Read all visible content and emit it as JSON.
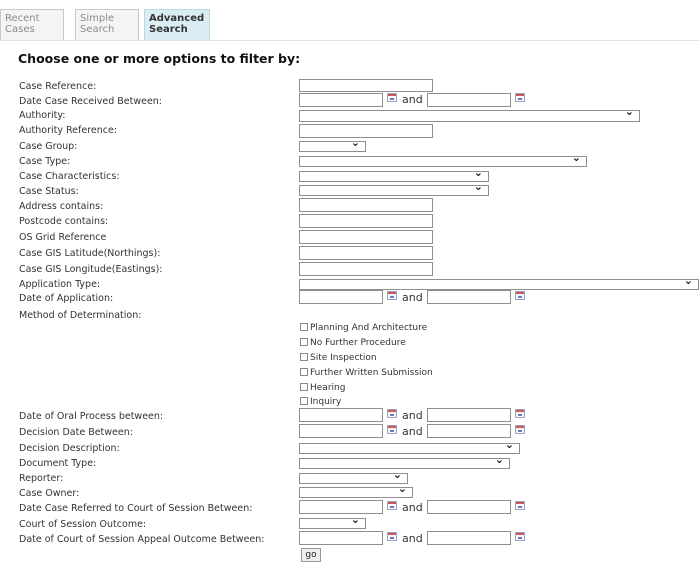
{
  "tabs": [
    {
      "l1": "Recent",
      "l2": "Cases"
    },
    {
      "l1": "Simple",
      "l2": "Search"
    },
    {
      "l1": "Advanced",
      "l2": "Search"
    }
  ],
  "heading": "Choose one or more options to filter by:",
  "labels": {
    "case_reference": "Case Reference:",
    "date_received": "Date Case Received Between:",
    "authority": "Authority:",
    "authority_reference": "Authority Reference:",
    "case_group": "Case Group:",
    "case_type": "Case Type:",
    "case_characteristics": "Case Characteristics:",
    "case_status": "Case Status:",
    "address": "Address contains:",
    "postcode": "Postcode contains:",
    "os_grid": "OS Grid Reference",
    "gis_lat": "Case GIS Latitude(Northings):",
    "gis_long": "Case GIS Longitude(Eastings):",
    "application_type": "Application Type:",
    "date_application": "Date of Application:",
    "method": "Method of Determination:",
    "oral_process": "Date of Oral Process between:",
    "decision_date": "Decision Date Between:",
    "decision_description": "Decision Description:",
    "document_type": "Document Type:",
    "reporter": "Reporter:",
    "case_owner": "Case Owner:",
    "court_referred": "Date Case Referred to Court of Session Between:",
    "court_outcome": "Court of Session Outcome:",
    "court_appeal": "Date of Court of Session Appeal Outcome Between:"
  },
  "and_text": "and",
  "methods": [
    "Planning And Architecture",
    "No Further Procedure",
    "Site Inspection",
    "Further Written Submission",
    "Hearing",
    "Inquiry"
  ],
  "go_button": "go"
}
